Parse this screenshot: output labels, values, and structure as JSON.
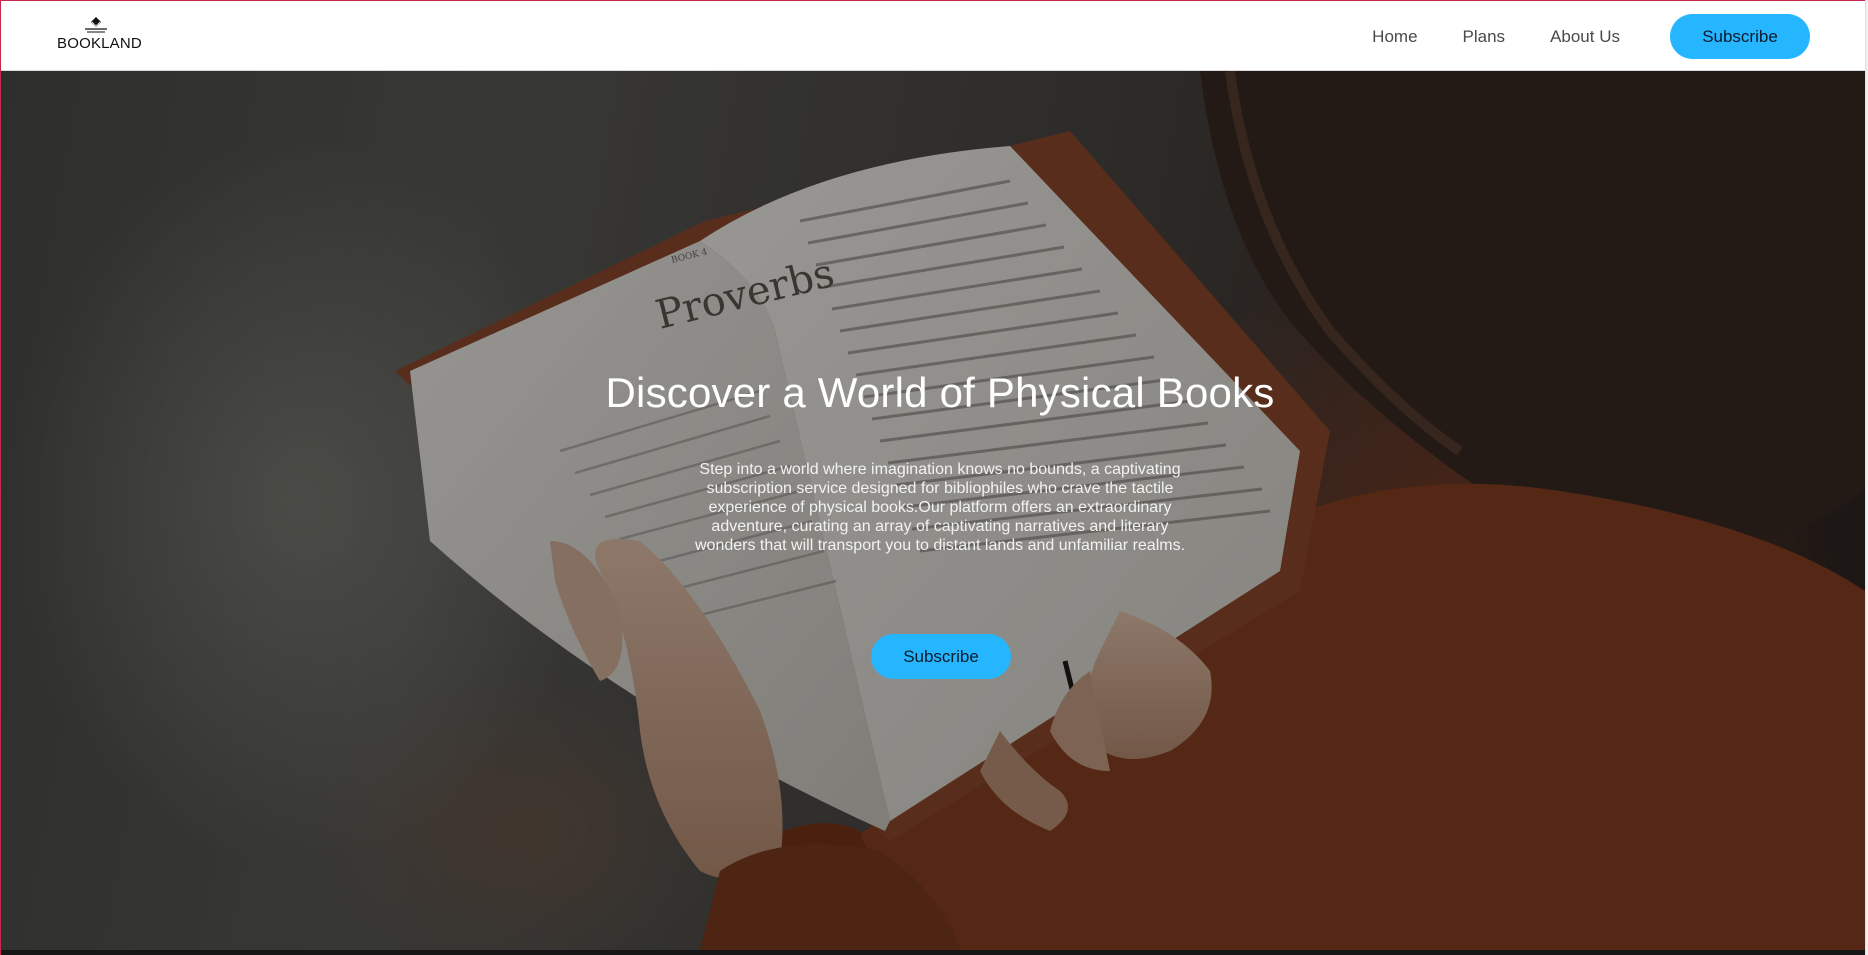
{
  "header": {
    "logo_text": "BOOKLAND",
    "nav": {
      "home": "Home",
      "plans": "Plans",
      "about": "About Us",
      "subscribe": "Subscribe"
    }
  },
  "hero": {
    "title": "Discover a World of Physical Books",
    "description": "Step into a world where imagination knows no bounds, a captivating subscription service designed for bibliophiles who crave the tactile experience of physical books.Our platform offers an extraordinary adventure, curating an array of captivating narratives and literary wonders that will transport you to distant lands and unfamiliar realms.",
    "cta": "Subscribe",
    "image_text": {
      "book_heading": "Proverbs",
      "book_subheading": "BOOK 4"
    }
  },
  "colors": {
    "accent": "#25b6ff",
    "button_text": "#0c1b2a",
    "header_bg": "#ffffff"
  },
  "icons": {
    "logo": "book-stack-icon"
  }
}
